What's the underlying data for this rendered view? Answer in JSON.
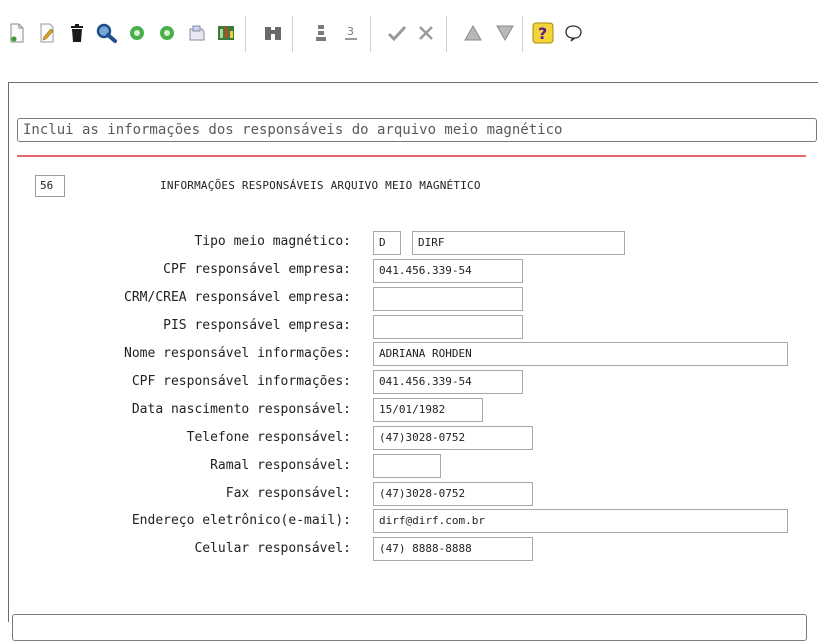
{
  "toolbar": {
    "icons": [
      "new-document-icon",
      "edit-pencil-icon",
      "delete-trash-icon",
      "search-magnifier-icon",
      "previous-record-icon",
      "next-record-icon",
      "save-icon",
      "export-icon",
      "find-binoculars-icon",
      "sort-ascending-icon",
      "sort-numbered-icon",
      "confirm-check-icon",
      "cancel-icon",
      "first-record-icon",
      "last-record-icon",
      "help-icon",
      "comment-icon"
    ]
  },
  "description": "Inclui as informações dos responsáveis do arquivo meio magnético",
  "form": {
    "code": "56",
    "title": "INFORMAÇÕES RESPONSÁVEIS ARQUIVO MEIO MAGNÉTICO",
    "fields": {
      "tipo": {
        "label": "Tipo meio magnético:",
        "code": "D",
        "value": "DIRF"
      },
      "cpf_empresa": {
        "label": "CPF responsável empresa:",
        "value": "041.456.339-54"
      },
      "crm_crea": {
        "label": "CRM/CREA responsável empresa:",
        "value": ""
      },
      "pis": {
        "label": "PIS responsável empresa:",
        "value": ""
      },
      "nome": {
        "label": "Nome responsável informações:",
        "value": "ADRIANA ROHDEN"
      },
      "cpf_info": {
        "label": "CPF responsável informações:",
        "value": "041.456.339-54"
      },
      "nascimento": {
        "label": "Data nascimento responsável:",
        "value": "15/01/1982"
      },
      "telefone": {
        "label": "Telefone responsável:",
        "value": "(47)3028-0752"
      },
      "ramal": {
        "label": "Ramal responsável:",
        "value": ""
      },
      "fax": {
        "label": "Fax responsável:",
        "value": "(47)3028-0752"
      },
      "email": {
        "label": "Endereço eletrônico(e-mail):",
        "value": "dirf@dirf.com.br"
      },
      "celular": {
        "label": "Celular responsável:",
        "value": "(47) 8888-8888"
      }
    }
  },
  "status": {
    "text": ""
  }
}
